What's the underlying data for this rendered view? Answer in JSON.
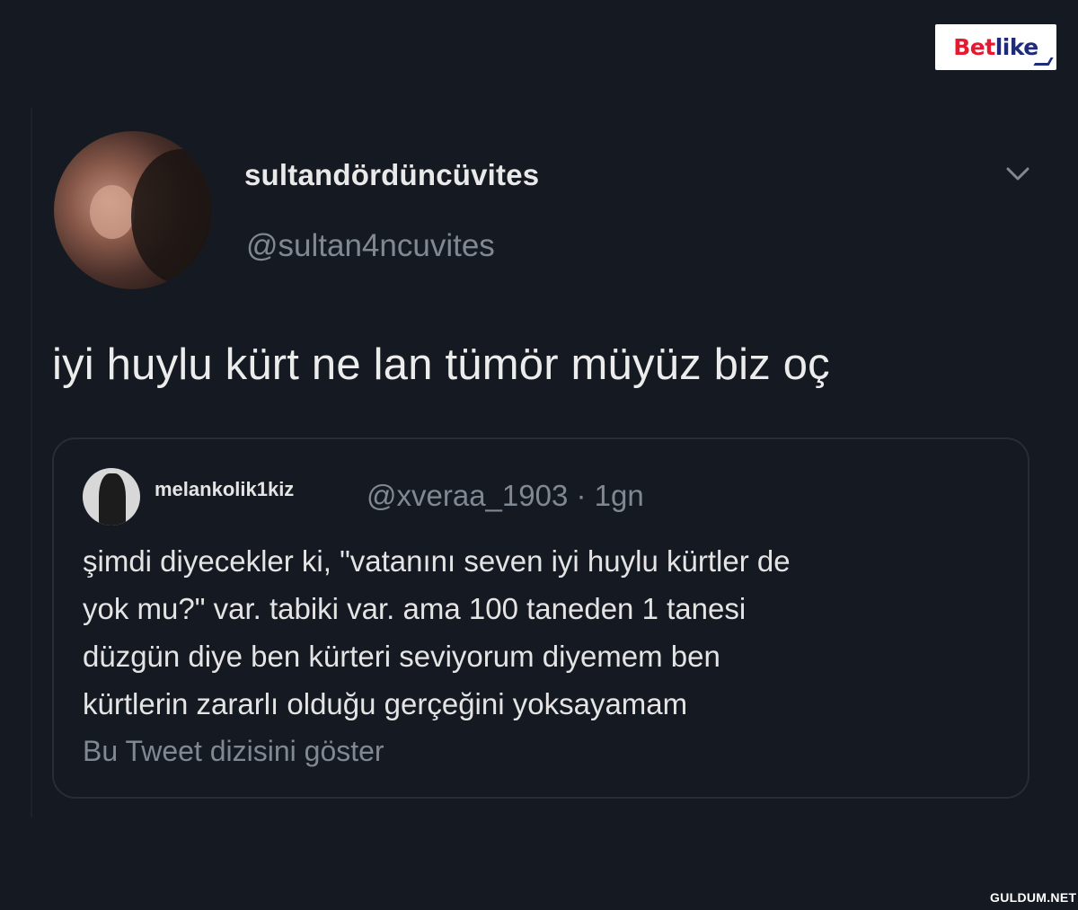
{
  "brand": {
    "logo_text_part1": "Bet",
    "logo_text_part2": "like",
    "watermark": "GULDUM.NET"
  },
  "tweet": {
    "display_name": "sultandördüncüvites",
    "handle": "@sultan4ncuvites",
    "text": "iyi huylu kürt ne lan tümör müyüz biz oç",
    "menu_icon": "chevron-down-icon"
  },
  "quoted_tweet": {
    "display_name": "melankolik1kiz",
    "handle_and_time": "@xveraa_1903 · 1gn",
    "lines": [
      "şimdi diyecekler ki, \"vatanını seven iyi huylu kürtler de",
      "yok mu?\" var. tabiki var. ama 100 taneden 1 tanesi",
      "düzgün diye ben kürteri seviyorum diyemem ben",
      "kürtlerin zararlı olduğu gerçeğini yoksayamam"
    ],
    "show_thread": "Bu Tweet dizisini göster"
  },
  "colors": {
    "background": "#151a22",
    "text_primary": "#e8e8e8",
    "text_secondary": "#7f8893",
    "border": "#262d37",
    "logo_red": "#e5192f",
    "logo_navy": "#1f2a7a"
  }
}
